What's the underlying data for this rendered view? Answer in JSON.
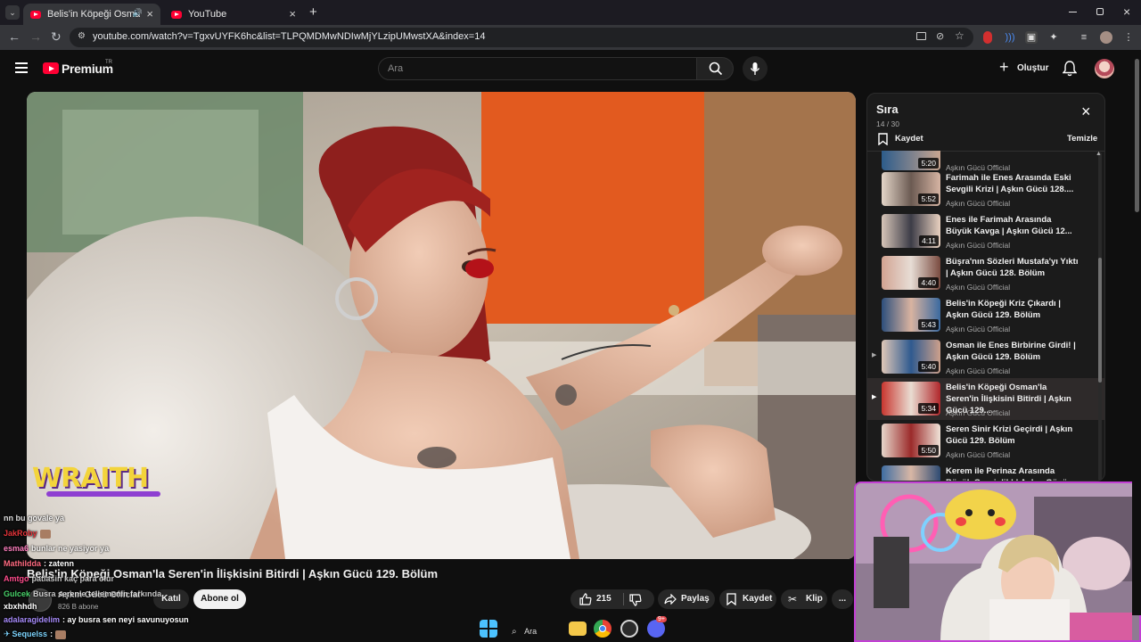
{
  "browser": {
    "tabs": [
      {
        "title": "Belis'in Köpeği Osman'la Se",
        "active": true
      },
      {
        "title": "YouTube",
        "active": false
      }
    ],
    "new_tab": "+",
    "url": "youtube.com/watch?v=TgxvUYFK6hc&list=TLPQMDMwNDIwMjYLzipUMwstXA&index=14"
  },
  "header": {
    "logo_text": "Premium",
    "logo_sup": "TR",
    "search_placeholder": "Ara",
    "create_label": "Oluştur"
  },
  "video": {
    "watermark": "WRAITH"
  },
  "queue": {
    "title": "Sıra",
    "position": "14 / 30",
    "save_label": "Kaydet",
    "clear_label": "Temizle",
    "items": [
      {
        "title": "",
        "duration": "5:20",
        "channel": "Aşkın Gücü Official"
      },
      {
        "title": "Farimah ile Enes Arasında Eski Sevgili Krizi | Aşkın Gücü 128....",
        "duration": "5:52",
        "channel": "Aşkın Gücü Official"
      },
      {
        "title": "Enes ile Farimah Arasında Büyük Kavga | Aşkın Gücü 12...",
        "duration": "4:11",
        "channel": "Aşkın Gücü Official"
      },
      {
        "title": "Büşra'nın Sözleri Mustafa'yı Yıktı | Aşkın Gücü 128. Bölüm",
        "duration": "4:40",
        "channel": "Aşkın Gücü Official"
      },
      {
        "title": "Belis'in Köpeği Kriz Çıkardı | Aşkın Gücü 129. Bölüm",
        "duration": "5:43",
        "channel": "Aşkın Gücü Official"
      },
      {
        "title": "Osman ile Enes Birbirine Girdi! | Aşkın Gücü 129. Bölüm",
        "duration": "5:40",
        "channel": "Aşkın Gücü Official"
      },
      {
        "title": "Belis'in Köpeği Osman'la Seren'in İlişkisini Bitirdi | Aşkın Gücü 129....",
        "duration": "5:34",
        "channel": "Aşkın Gücü Official"
      },
      {
        "title": "Seren Sinir Krizi Geçirdi | Aşkın Gücü 129. Bölüm",
        "duration": "5:50",
        "channel": "Aşkın Gücü Official"
      },
      {
        "title": "Kerem ile Perinaz Arasında Büyük Gerginlik! | Aşkın Gücü...",
        "duration": "",
        "channel": ""
      }
    ]
  },
  "below_video": {
    "title": "Belis'in Köpeği Osman'la Seren'in İlişkisini Bitirdi | Aşkın Gücü 129. Bölüm",
    "channel": "Aşkın Gücü Official",
    "subscribers": "826 B abone",
    "join_label": "Katıl",
    "subscribe_label": "Abone ol",
    "likes": "215",
    "share_label": "Paylaş",
    "save_label": "Kaydet",
    "clip_label": "Klip",
    "more": "..."
  },
  "chat": [
    {
      "name": "",
      "message": "nn bu govale ya",
      "color": "#ffffff"
    },
    {
      "name": "JakRoby",
      "message": "",
      "color": "#e4343a"
    },
    {
      "name": "esma6",
      "message": "bunlar ne yasiyor ya",
      "color": "#ff7fbf"
    },
    {
      "name": "Mathildda",
      "message": ": zatenn",
      "color": "#ff6b81"
    },
    {
      "name": "Amtgo",
      "message": "patlasin kaç para olur",
      "color": "#ff4d8d"
    },
    {
      "name": "Gulcek",
      "message": "Busra serenle tellemenin farkında",
      "color": "#49d36a"
    },
    {
      "name": "xbxhhdh",
      "message": "",
      "color": "#ffffff"
    },
    {
      "name": "adalaragidelim",
      "message": ": ay busra sen neyi savunuyosun",
      "color": "#a78bfa"
    },
    {
      "name": "Sequelss",
      "message": ":",
      "color": "#7dd3fc"
    }
  ],
  "taskbar": {
    "search_label": "Ara",
    "discord_badge": "9+"
  },
  "colors": {
    "youtube_red": "#ff0033",
    "webcam_border": "#c23fd4"
  }
}
